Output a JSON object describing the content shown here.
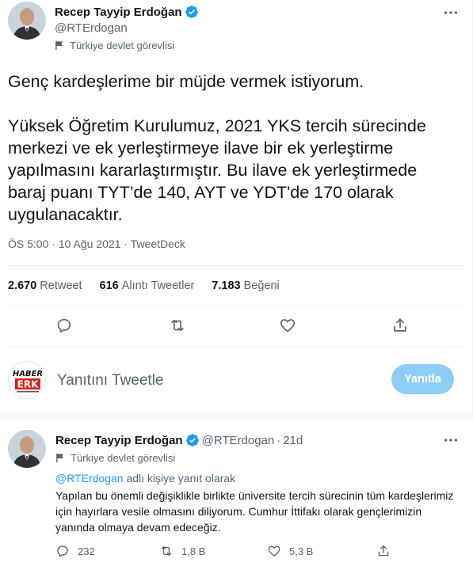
{
  "tweet": {
    "author_name": "Recep Tayyip Erdoğan",
    "handle": "@RTErdogan",
    "account_label": "Türkiye devlet görevlisi",
    "text_line1": "Genç kardeşlerime bir müjde vermek istiyorum.",
    "text_paragraph2": "Yüksek Öğretim Kurulumuz, 2021 YKS tercih sürecinde merkezi ve ek yerleştirmeye ilave bir ek yerleştirme yapılmasını kararlaştırmıştır. Bu ilave ek yerleştirmede baraj puanı TYT’de 140, AYT ve YDT'de 170 olarak uygulanacaktır.",
    "time": "ÖS 5:00",
    "date": "10 Ağu 2021",
    "source": "TweetDeck",
    "meta_separator": "·"
  },
  "stats": {
    "retweets_count": "2.670",
    "retweets_label": "Retweet",
    "quotes_count": "616",
    "quotes_label": "Alıntı Tweetler",
    "likes_count": "7.183",
    "likes_label": "Beğeni"
  },
  "reply_composer": {
    "placeholder": "Yanıtını Tweetle",
    "button_label": "Yanıtla",
    "avatar_logo_top": "HABER",
    "avatar_logo_bottom": "ERK"
  },
  "reply": {
    "author_name": "Recep Tayyip Erdoğan",
    "handle": "@RTErdogan",
    "time_ago": "21d",
    "separator": "·",
    "account_label": "Türkiye devlet görevlisi",
    "reply_to_mention": "@RTErdogan",
    "reply_to_suffix": "adlı kişiye yanıt olarak",
    "text": "Yapılan bu önemli değişiklikle birlikte üniversite tercih sürecinin tüm kardeşlerimiz için hayırlara vesile olmasını diliyorum. Cumhur İttifakı olarak gençlerimizin yanında olmaya devam edeceğiz.",
    "reply_count": "232",
    "retweet_count": "1,8 B",
    "like_count": "5,3 B"
  },
  "colors": {
    "accent": "#1d9bf0",
    "button_disabled": "#8ecdf8",
    "secondary_text": "#536471"
  }
}
